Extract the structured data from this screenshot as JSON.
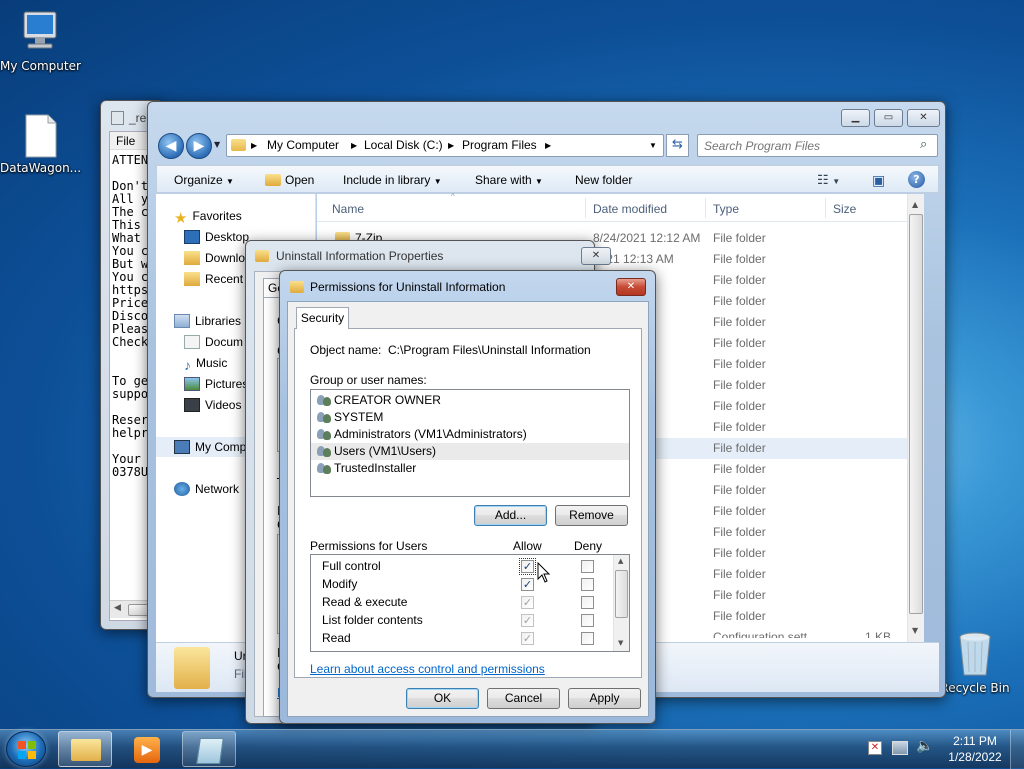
{
  "desktop": {
    "icons": [
      {
        "label": "My Computer"
      },
      {
        "label": "DataWagon..."
      },
      {
        "label": "Recycle Bin"
      }
    ]
  },
  "notepad": {
    "title": "_rea",
    "menu": "File",
    "lines": [
      "ATTEN",
      "",
      "Don't",
      "All y",
      "The c",
      "This",
      "What",
      "You c",
      "But w",
      "You c",
      "https",
      "Price",
      "Disco",
      "Pleas",
      "Check",
      "",
      "",
      "To ge",
      "suppo",
      "",
      "Reser",
      "helpr",
      "",
      "Your",
      "0378U"
    ]
  },
  "explorer": {
    "breadcrumb": [
      "My Computer",
      "Local Disk (C:)",
      "Program Files"
    ],
    "search_placeholder": "Search Program Files",
    "toolbar": {
      "organize": "Organize",
      "open": "Open",
      "include": "Include in library",
      "share": "Share with",
      "newfolder": "New folder"
    },
    "nav": {
      "favorites": "Favorites",
      "desktop": "Desktop",
      "downloads": "Downlo",
      "recent": "Recent",
      "libraries": "Libraries",
      "documents": "Docum",
      "music": "Music",
      "pictures": "Pictures",
      "videos": "Videos",
      "computer": "My Comp",
      "network": "Network"
    },
    "columns": {
      "name": "Name",
      "date": "Date modified",
      "type": "Type",
      "size": "Size"
    },
    "files": [
      {
        "name": "7-Zip",
        "date": "8/24/2021 12:12 AM",
        "type": "File folder",
        "size": ""
      },
      {
        "name": "",
        "date": "2021 12:13 AM",
        "type": "File folder",
        "size": ""
      },
      {
        "name": "",
        "date": ":20 PM",
        "type": "File folder",
        "size": ""
      },
      {
        "name": "",
        "date": ":37 PM",
        "type": "File folder",
        "size": ""
      },
      {
        "name": "",
        "date": ":37 PM",
        "type": "File folder",
        "size": ""
      },
      {
        "name": "",
        "date": "28 AM",
        "type": "File folder",
        "size": ""
      },
      {
        "name": "",
        "date": "04 PM",
        "type": "File folder",
        "size": ""
      },
      {
        "name": "",
        "date": "32 AM",
        "type": "File folder",
        "size": ""
      },
      {
        "name": "",
        "date": "55 PM",
        "type": "File folder",
        "size": ""
      },
      {
        "name": "",
        "date": "32 AM",
        "type": "File folder",
        "size": ""
      },
      {
        "name": "",
        "date": "09 AM",
        "type": "File folder",
        "size": ""
      },
      {
        "name": "",
        "date": ":23 PM",
        "type": "File folder",
        "size": ""
      },
      {
        "name": "",
        "date": "17 AM",
        "type": "File folder",
        "size": ""
      },
      {
        "name": "",
        "date": ":35 PM",
        "type": "File folder",
        "size": ""
      },
      {
        "name": "",
        "date": "32 AM",
        "type": "File folder",
        "size": ""
      },
      {
        "name": "",
        "date": "17 AM",
        "type": "File folder",
        "size": ""
      },
      {
        "name": "",
        "date": "10:31 ...",
        "type": "File folder",
        "size": ""
      },
      {
        "name": "",
        "date": "17 AM",
        "type": "File folder",
        "size": ""
      },
      {
        "name": "",
        "date": "5:52 PM",
        "type": "File folder",
        "size": ""
      },
      {
        "name": "",
        "date": "2:54 AM",
        "type": "Configuration sett...",
        "size": "1 KB"
      }
    ],
    "details": {
      "name": "Ur",
      "type": "Fil"
    }
  },
  "props": {
    "title": "Uninstall Information Properties",
    "tab_fragment": "Ge",
    "letters": [
      "C",
      "G",
      "T",
      "F",
      "C",
      "F",
      "C",
      "L"
    ]
  },
  "perm": {
    "title": "Permissions for Uninstall Information",
    "tab": "Security",
    "object_label": "Object name:",
    "object_value": "C:\\Program Files\\Uninstall Information",
    "group_label": "Group or user names:",
    "users": [
      "CREATOR OWNER",
      "SYSTEM",
      "Administrators (VM1\\Administrators)",
      "Users (VM1\\Users)",
      "TrustedInstaller"
    ],
    "selected_user": 3,
    "add": "Add...",
    "remove": "Remove",
    "perm_header": "Permissions for Users",
    "allow": "Allow",
    "deny": "Deny",
    "permissions": [
      {
        "name": "Full control",
        "allow": true,
        "allow_disabled": false,
        "deny": false
      },
      {
        "name": "Modify",
        "allow": true,
        "allow_disabled": false,
        "deny": false
      },
      {
        "name": "Read & execute",
        "allow": true,
        "allow_disabled": true,
        "deny": false
      },
      {
        "name": "List folder contents",
        "allow": true,
        "allow_disabled": true,
        "deny": false
      },
      {
        "name": "Read",
        "allow": true,
        "allow_disabled": true,
        "deny": false
      }
    ],
    "link": "Learn about access control and permissions",
    "ok": "OK",
    "cancel": "Cancel",
    "apply": "Apply"
  },
  "taskbar": {
    "time": "2:11 PM",
    "date": "1/28/2022"
  }
}
